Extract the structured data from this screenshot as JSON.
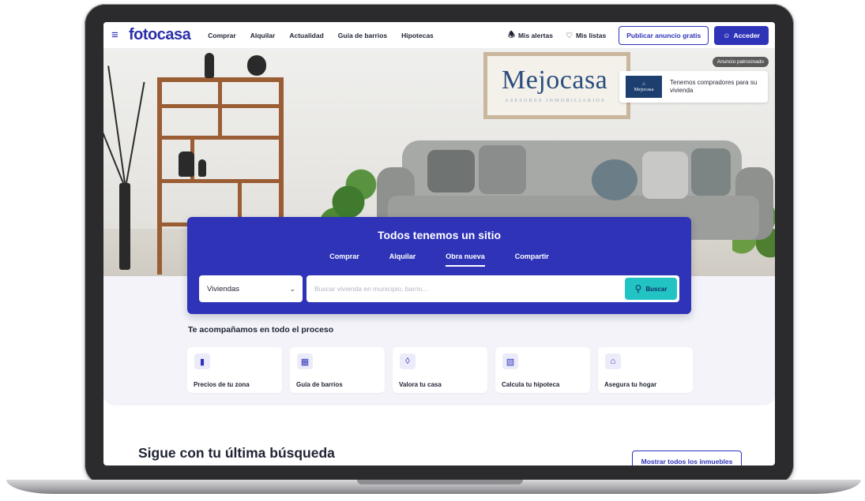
{
  "header": {
    "logo": "fotocasa",
    "menu_icon": "hamburger-menu-icon",
    "nav": [
      "Comprar",
      "Alquilar",
      "Actualidad",
      "Guía de barrios",
      "Hipotecas"
    ],
    "alerts_label": "Mis alertas",
    "lists_label": "Mis listas",
    "publish_label": "Publicar anuncio gratis",
    "login_label": "Acceder"
  },
  "hero": {
    "frame_brand": "Mejocasa",
    "frame_tagline": "ASESORES INMOBILIARIOS",
    "sponsor_tag": "Anuncio patrocinado",
    "sponsor_logo_text": "Mejocasa",
    "sponsor_text": "Tenemos compradores para su vivienda"
  },
  "search": {
    "title": "Todos tenemos un sitio",
    "tabs": [
      "Comprar",
      "Alquilar",
      "Obra nueva",
      "Compartir"
    ],
    "active_tab": "Obra nueva",
    "property_type": "Viviendas",
    "placeholder": "Buscar vivienda en municipio, barrio...",
    "button_label": "Buscar"
  },
  "process": {
    "title": "Te acompañamos en todo el proceso",
    "cards": [
      {
        "label": "Precios de tu zona",
        "icon": "price-chart-icon"
      },
      {
        "label": "Guía de barrios",
        "icon": "buildings-icon"
      },
      {
        "label": "Valora tu casa",
        "icon": "tag-icon"
      },
      {
        "label": "Calcula tu hipoteca",
        "icon": "calculator-icon"
      },
      {
        "label": "Asegura tu hogar",
        "icon": "house-heart-icon"
      }
    ]
  },
  "last_search": {
    "title": "Sigue con tu última búsqueda",
    "show_all_label": "Mostrar todos los inmuebles"
  },
  "colors": {
    "brand": "#2e33b8",
    "accent": "#22c3c3"
  }
}
